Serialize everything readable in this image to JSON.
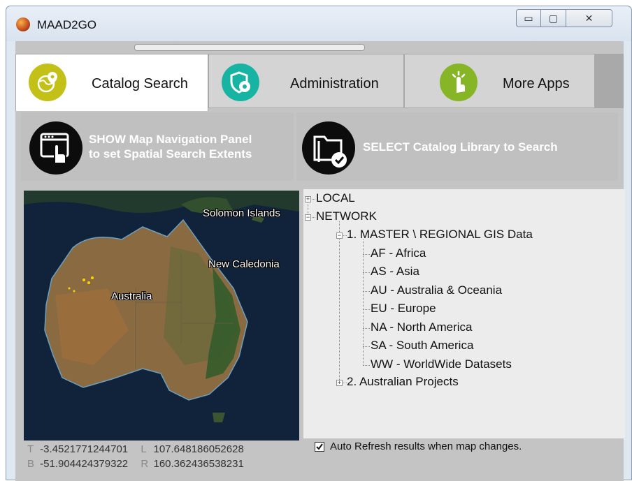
{
  "window": {
    "title": "MAAD2GO",
    "controls": {
      "minimize_glyph": "▭",
      "maximize_glyph": "▢",
      "close_glyph": "✕"
    }
  },
  "tabs": [
    {
      "label": "Catalog Search",
      "icon": "globe-pin-icon",
      "color": "#c3c018",
      "active": true
    },
    {
      "label": "Administration",
      "icon": "shield-gear-icon",
      "color": "#17b3a3",
      "active": false
    },
    {
      "label": "More Apps",
      "icon": "tap-hand-icon",
      "color": "#86b625",
      "active": false
    }
  ],
  "actions": {
    "navigation": {
      "line1": "SHOW Map Navigation Panel",
      "line2": "to set Spatial Search Extents",
      "icon": "browser-hand-icon"
    },
    "catalog": {
      "label": "SELECT Catalog Library to Search",
      "icon": "folder-check-icon"
    }
  },
  "map": {
    "labels": {
      "solomon": "Solomon Islands",
      "caledonia": "New Caledonia",
      "australia": "Australia"
    }
  },
  "extent": {
    "top_key": "T",
    "top": "-3.4521771244701",
    "left_key": "L",
    "left": "107.648186052628",
    "bottom_key": "B",
    "bottom": "-51.904424379322",
    "right_key": "R",
    "right": "160.362436538231"
  },
  "tree": {
    "local": "LOCAL",
    "network": "NETWORK",
    "master": "1. MASTER \\ REGIONAL GIS Data",
    "regions": [
      "AF - Africa",
      "AS - Asia",
      "AU - Australia & Oceania",
      "EU - Europe",
      "NA - North America",
      "SA - South America",
      "WW - WorldWide Datasets"
    ],
    "projects": "2. Australian Projects",
    "expand_glyph": "+",
    "collapse_glyph": "−"
  },
  "auto_refresh": {
    "label": "Auto Refresh results when map changes.",
    "checked": true
  },
  "colors": {
    "action_text": "#ffffff",
    "client_bg": "#c4c4c4",
    "tree_bg": "#ececec"
  }
}
